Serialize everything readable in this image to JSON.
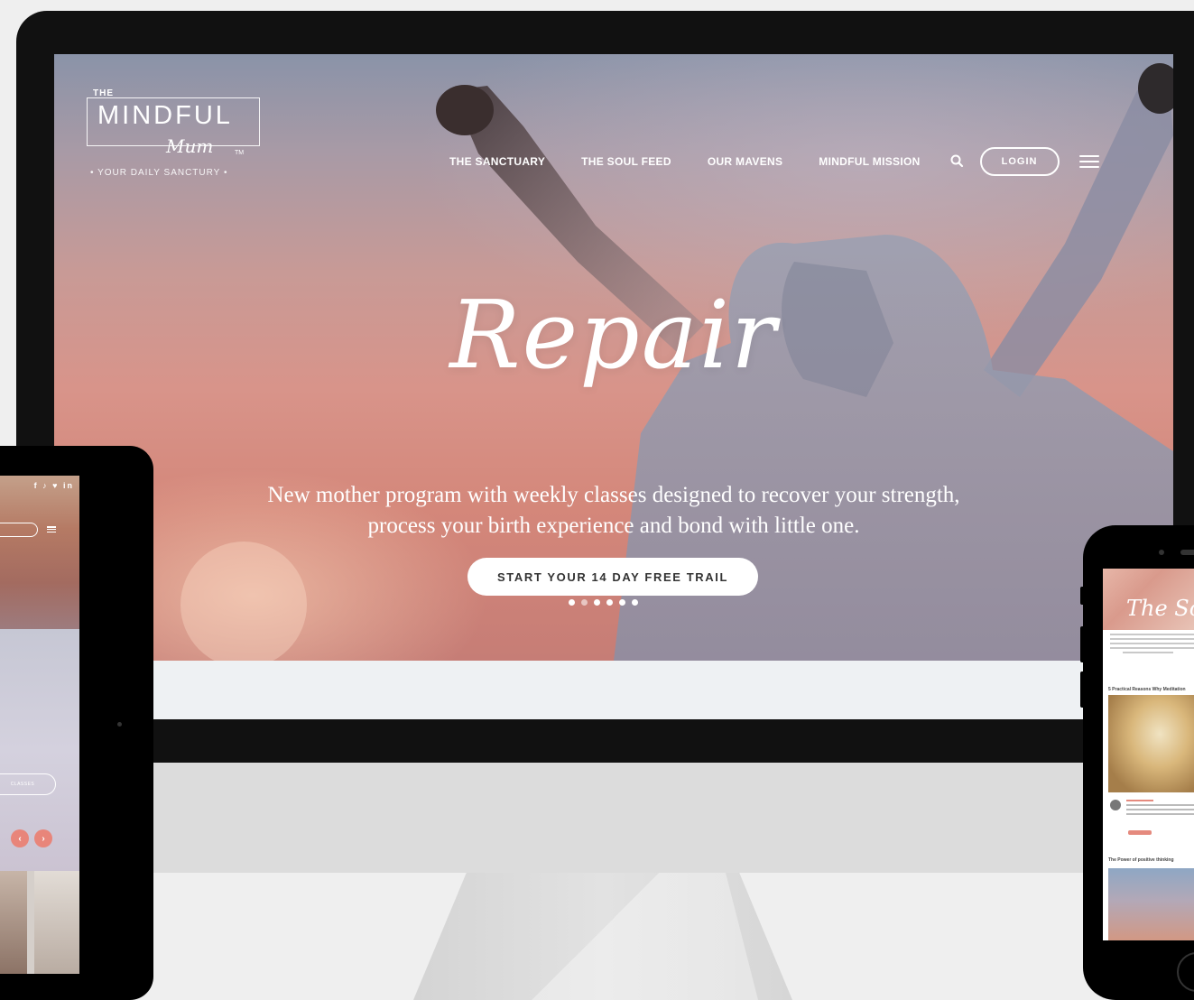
{
  "desktop": {
    "logo": {
      "the": "THE",
      "mindful": "MINDFUL",
      "mum": "Mum",
      "tm": "TM",
      "tagline": "• YOUR DAILY SANCTURY •"
    },
    "nav": {
      "items": [
        "THE SANCTUARY",
        "THE SOUL FEED",
        "OUR MAVENS",
        "MINDFUL MISSION"
      ],
      "login_label": "LOGIN"
    },
    "hero": {
      "title": "Repair",
      "subtitle_line1": "New mother program with weekly classes designed to recover your strength,",
      "subtitle_line2": "process your birth experience and bond with little one.",
      "cta_label": "START YOUR 14 DAY FREE TRAIL",
      "slide_count": 6,
      "active_slide": 1
    }
  },
  "tablet": {
    "social_icons": "f ♪ ♥ in",
    "classes_label": "CLASSES",
    "arrow_left": "‹",
    "arrow_right": "›"
  },
  "phone": {
    "feed_title": "The Soul Feed",
    "article1_title": "5 Practical Reasons Why Meditation",
    "article2_title": "The Power of positive thinking"
  },
  "colors": {
    "accent": "#e8857a",
    "frame": "#111111",
    "background": "#efefef"
  }
}
